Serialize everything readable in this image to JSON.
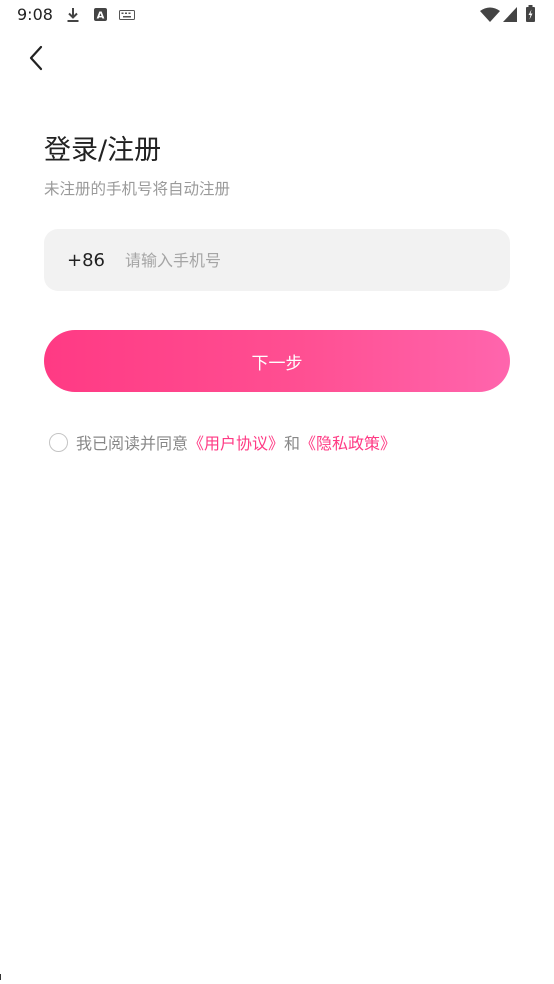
{
  "status_bar": {
    "time": "9:08",
    "left_icons": [
      "download-icon",
      "a-letter-icon",
      "keyboard-icon"
    ],
    "a_icon_letter": "A",
    "right_icons": [
      "wifi-icon",
      "cell-signal-icon",
      "battery-icon"
    ]
  },
  "nav": {
    "back_icon": "chevron-left-icon"
  },
  "header": {
    "title": "登录/注册",
    "subtitle": "未注册的手机号将自动注册"
  },
  "phone": {
    "country_code": "+86",
    "value": "",
    "placeholder": "请输入手机号"
  },
  "next_button": {
    "label": "下一步"
  },
  "agreement": {
    "checked": false,
    "text": "我已阅读并同意",
    "user_agreement": "《用户协议》",
    "and": "和",
    "privacy_policy": "《隐私政策》"
  },
  "colors": {
    "accent": "#ff3a84",
    "accent_end": "#ff65ad",
    "input_bg": "#f2f2f2",
    "subtitle_text": "#9a9a9a"
  }
}
